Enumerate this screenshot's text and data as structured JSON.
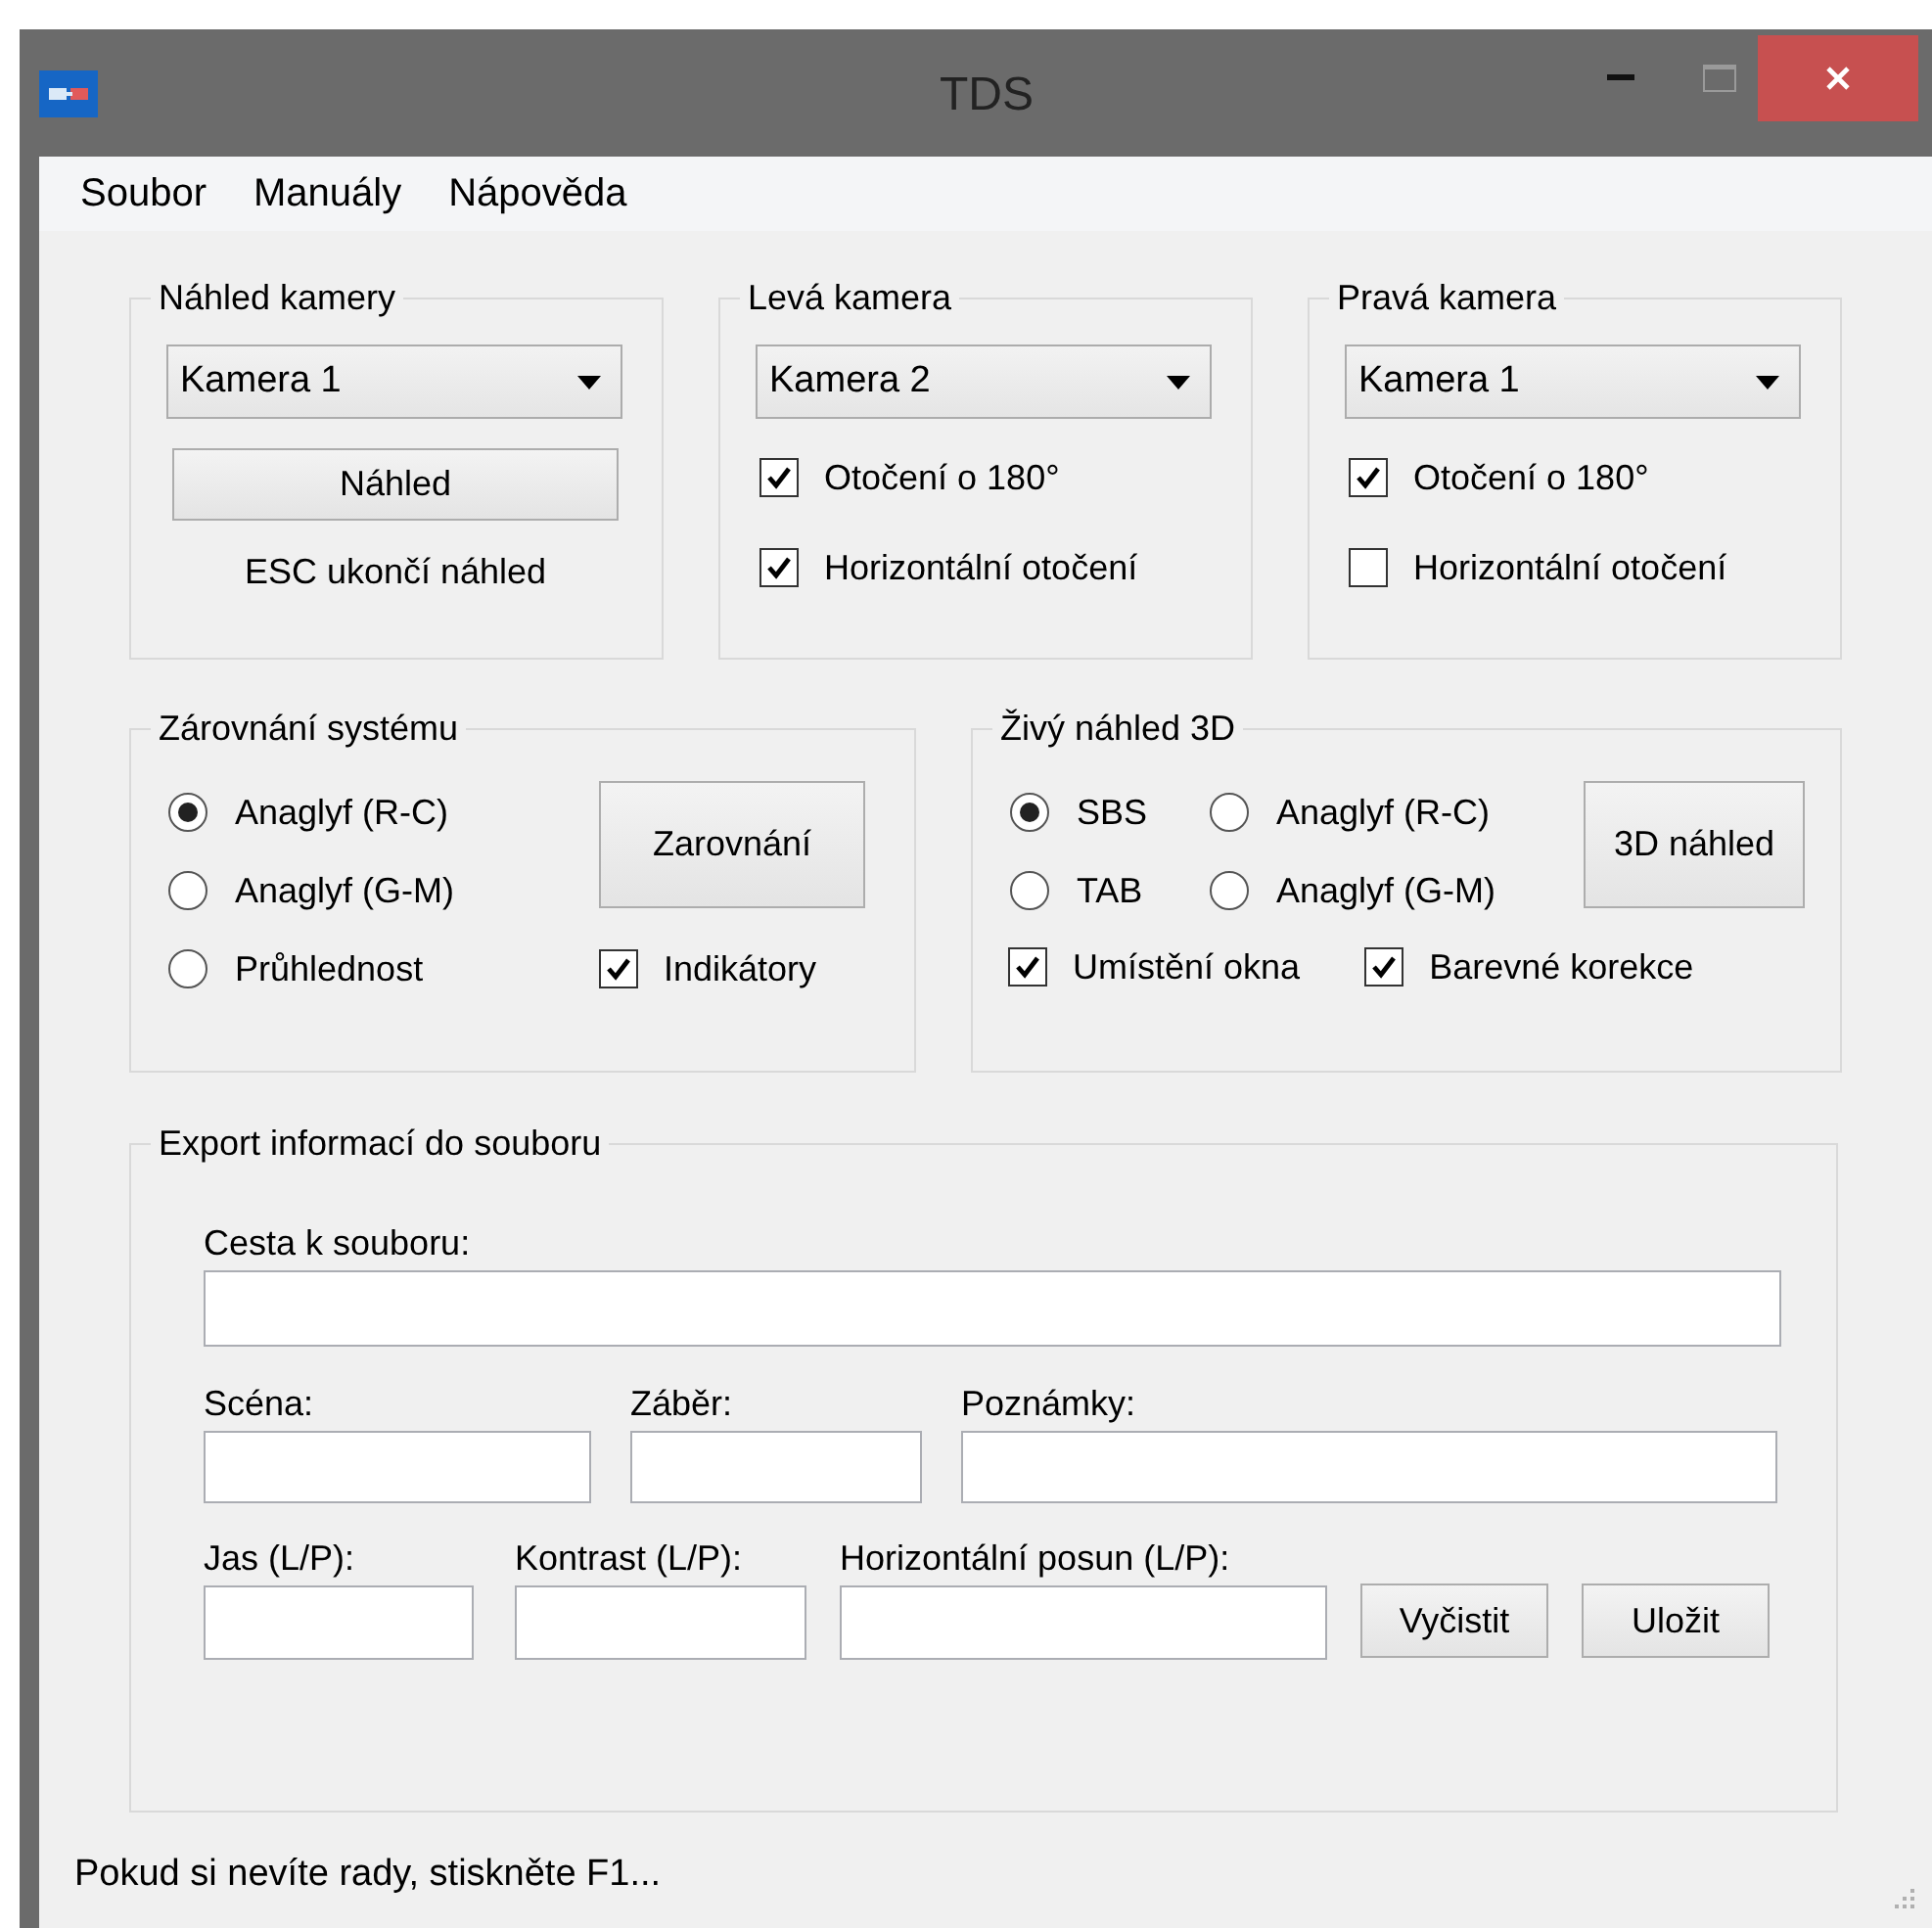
{
  "window": {
    "title": "TDS"
  },
  "menu": [
    "Soubor",
    "Manuály",
    "Nápověda"
  ],
  "camera_preview": {
    "title": "Náhled kamery",
    "camera": "Kamera 1",
    "button": "Náhled",
    "hint": "ESC ukončí náhled"
  },
  "left_camera": {
    "title": "Levá kamera",
    "camera": "Kamera 2",
    "options": [
      {
        "label": "Otočení o 180°",
        "checked": true
      },
      {
        "label": "Horizontální otočení",
        "checked": true
      }
    ]
  },
  "right_camera": {
    "title": "Pravá kamera",
    "camera": "Kamera 1",
    "options": [
      {
        "label": "Otočení o 180°",
        "checked": true
      },
      {
        "label": "Horizontální otočení",
        "checked": false
      }
    ]
  },
  "system_alignment": {
    "title": "Zárovnání systému",
    "modes": [
      {
        "label": "Anaglyf (R-C)",
        "selected": true
      },
      {
        "label": "Anaglyf (G-M)",
        "selected": false
      },
      {
        "label": "Průhlednost",
        "selected": false
      }
    ],
    "button": "Zarovnání",
    "indicators": {
      "label": "Indikátory",
      "checked": true
    }
  },
  "live_3d": {
    "title": "Živý náhled 3D",
    "modes": [
      {
        "label": "SBS",
        "selected": true
      },
      {
        "label": "Anaglyf (R-C)",
        "selected": false
      },
      {
        "label": "TAB",
        "selected": false
      },
      {
        "label": "Anaglyf (G-M)",
        "selected": false
      }
    ],
    "button": "3D náhled",
    "options": [
      {
        "label": "Umístění okna",
        "checked": true
      },
      {
        "label": "Barevné korekce",
        "checked": true
      }
    ]
  },
  "export": {
    "title": "Export informací do souboru",
    "fields": [
      {
        "label": "Cesta k souboru:"
      },
      {
        "label": "Scéna:"
      },
      {
        "label": "Záběr:"
      },
      {
        "label": "Poznámky:"
      },
      {
        "label": "Jas (L/P):"
      },
      {
        "label": "Kontrast (L/P):"
      },
      {
        "label": "Horizontální posun (L/P):"
      }
    ],
    "buttons": [
      "Vyčistit",
      "Uložit"
    ]
  },
  "status_bar": "Pokud si nevíte rady, stiskněte F1..."
}
